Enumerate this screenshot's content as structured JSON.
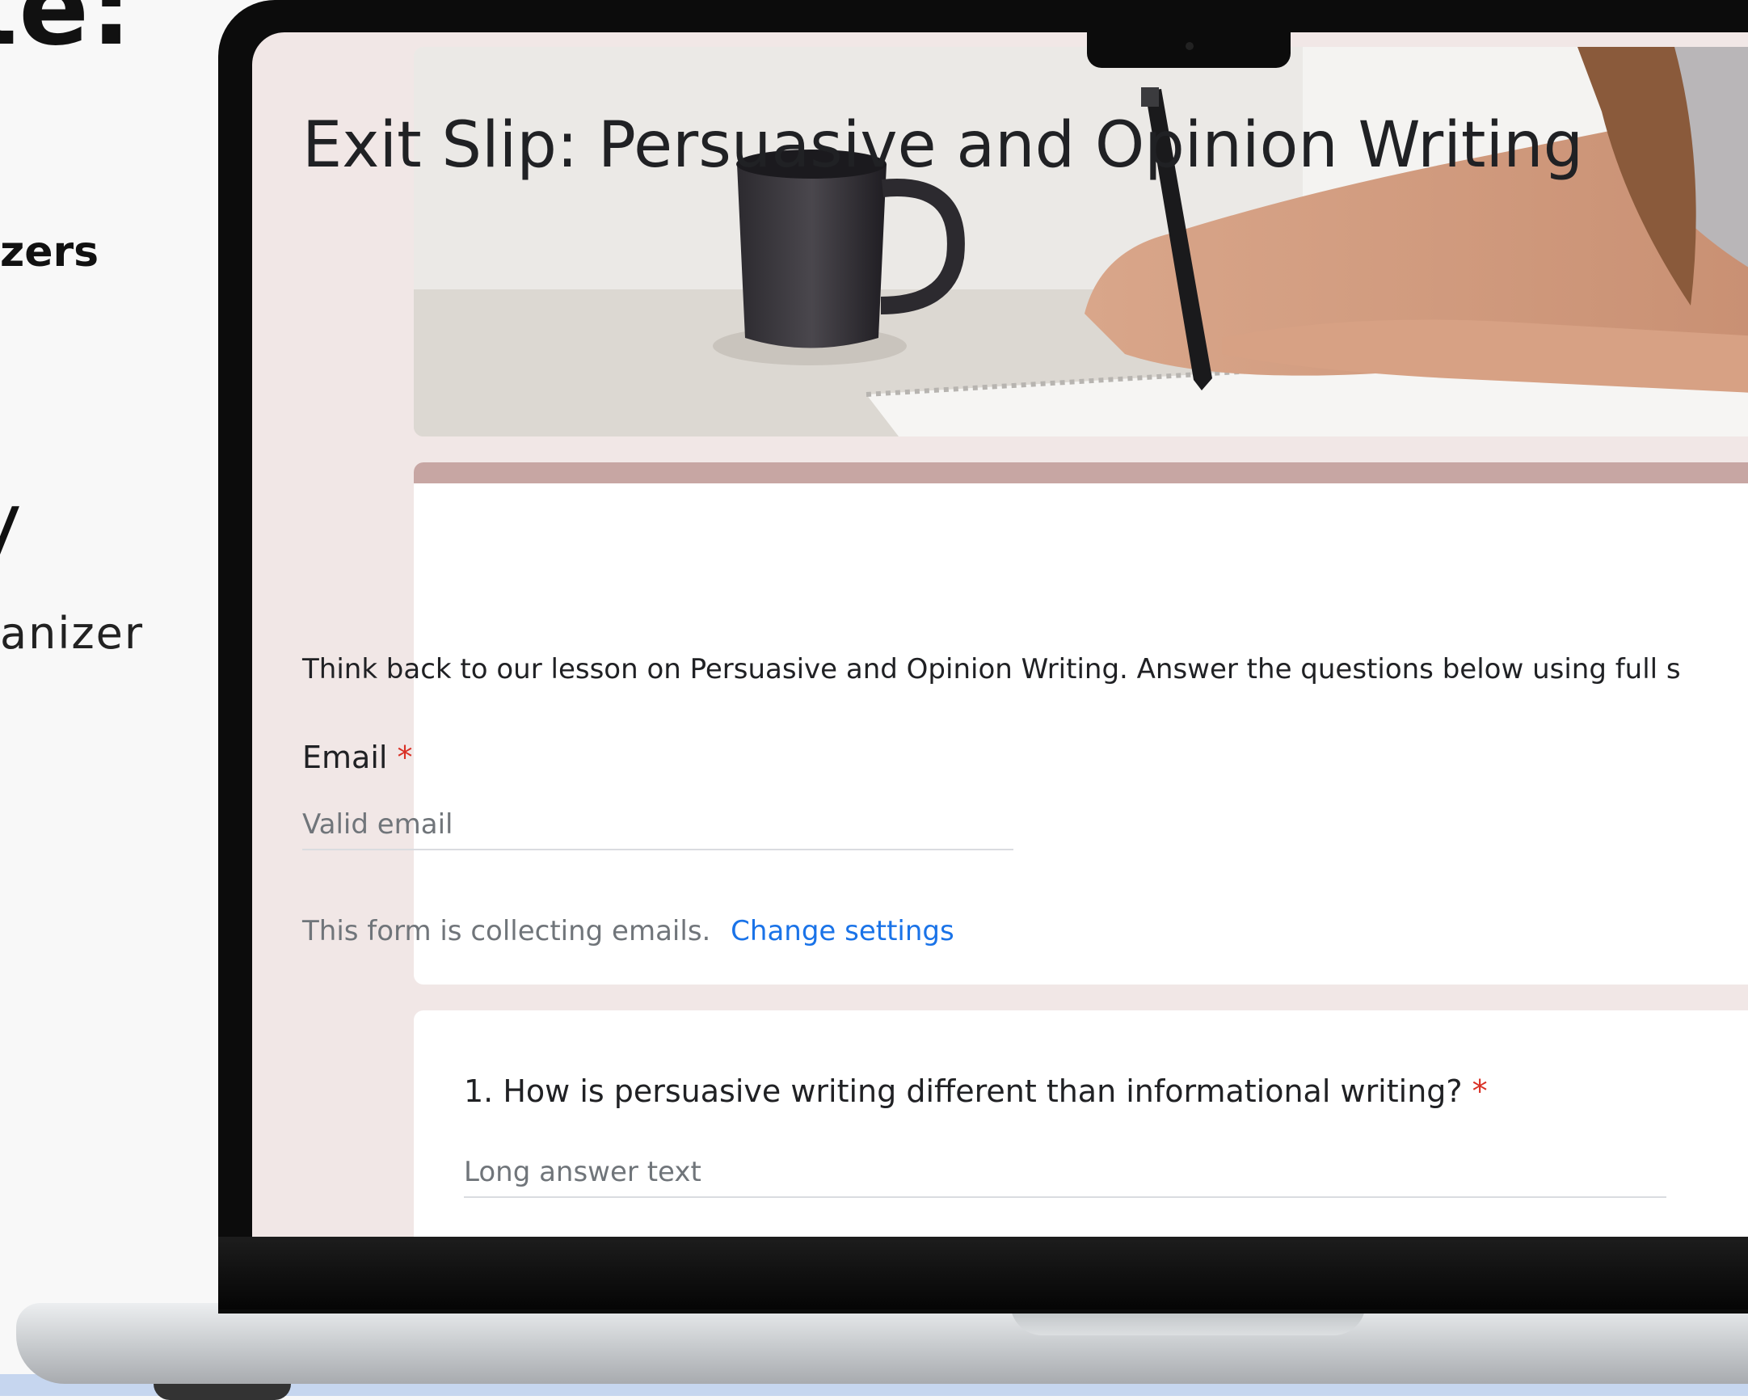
{
  "side_panel": {
    "heading_fragment": "te:",
    "sub_fragment_1": "zers",
    "big_fragment_2": "y",
    "sub_fragment_2": "anizer"
  },
  "form": {
    "title": "Exit Slip: Persuasive and Opinion Writing",
    "description": "Think back to our lesson on Persuasive and Opinion Writing.  Answer the questions below using full s",
    "email": {
      "label": "Email",
      "required_marker": "*",
      "placeholder": "Valid email"
    },
    "collecting_note": "This form is collecting emails.",
    "change_settings_label": "Change settings",
    "questions": [
      {
        "label": "1. How is persuasive writing different than informational writing?",
        "required_marker": "*",
        "placeholder": "Long answer text"
      }
    ]
  },
  "colors": {
    "accent": "#c7a6a3",
    "link": "#1a73e8",
    "required": "#d93025",
    "background": "#f1e7e6"
  }
}
